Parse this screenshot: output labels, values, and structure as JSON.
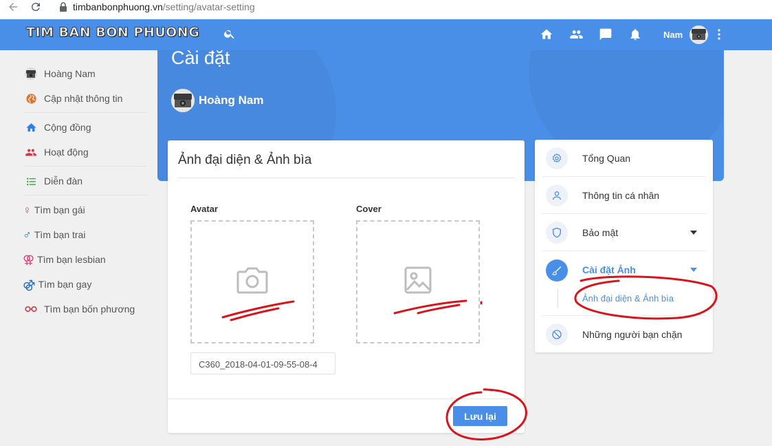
{
  "browser": {
    "url_domain": "timbanbonphuong.vn",
    "url_path": "/setting/avatar-setting"
  },
  "topbar": {
    "logo_text": "TIM BAN BON PHUONG",
    "user_name": "Nam"
  },
  "sidebar": {
    "items": [
      {
        "label": "Hoàng Nam",
        "icon": "user-avatar-icon"
      },
      {
        "label": "Cập nhật thông tin",
        "icon": "globe-icon"
      },
      {
        "label": "Cộng đồng",
        "icon": "home-icon"
      },
      {
        "label": "Hoạt động",
        "icon": "group-icon"
      },
      {
        "label": "Diễn đàn",
        "icon": "list-icon"
      },
      {
        "label": "Tìm bạn gái",
        "icon": "female-icon"
      },
      {
        "label": "Tìm bạn trai",
        "icon": "male-icon"
      },
      {
        "label": "Tìm bạn lesbian",
        "icon": "lesbian-icon"
      },
      {
        "label": "Tìm bạn gay",
        "icon": "gay-icon"
      },
      {
        "label": "Tìm bạn bốn phương",
        "icon": "glasses-icon"
      }
    ]
  },
  "header": {
    "page_title": "Cài đặt",
    "profile_name": "Hoàng Nam"
  },
  "main_card": {
    "title": "Ảnh đại diện & Ảnh bìa",
    "avatar_label": "Avatar",
    "cover_label": "Cover",
    "avatar_filename": "C360_2018-04-01-09-55-08-4",
    "save_label": "Lưu lại"
  },
  "settings_menu": {
    "items": [
      {
        "label": "Tổng Quan",
        "icon": "gear-icon"
      },
      {
        "label": "Thông tin cá nhân",
        "icon": "person-icon"
      },
      {
        "label": "Bảo mật",
        "icon": "shield-icon"
      },
      {
        "label": "Cài đặt Ảnh",
        "icon": "brush-icon"
      },
      {
        "label": "Những người bạn chặn",
        "icon": "block-icon"
      }
    ],
    "sub_item": "Ảnh đại diện & Ảnh bìa"
  },
  "colors": {
    "primary": "#4a8fe7",
    "annotation_red": "#d8141c"
  }
}
